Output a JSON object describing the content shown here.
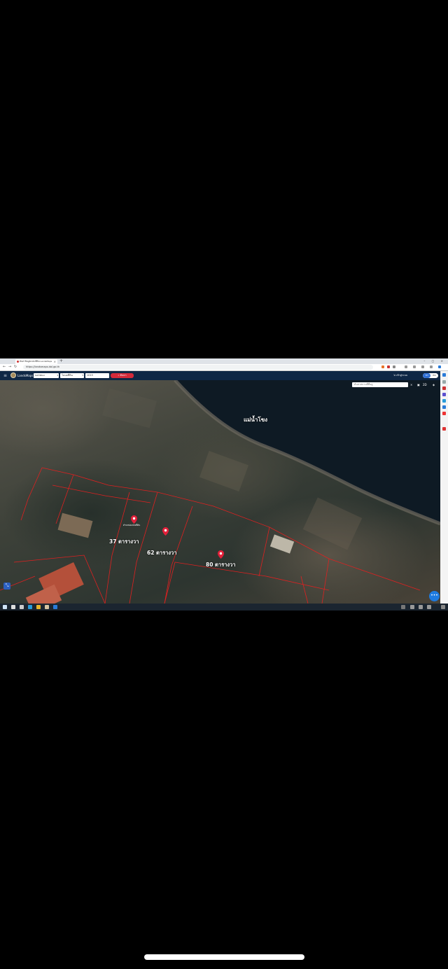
{
  "browser": {
    "tab_title": "ค้นหาข้อมูลแปลงที่ดิน LandsMaps",
    "url": "https://landsmaps.dol.go.th"
  },
  "app": {
    "brand": "LandsMaps",
    "province_select": "นครพนม",
    "parcel_type_select": "โฉนดที่ดิน",
    "parcel_number": "1015",
    "search_button": "ค้นหา",
    "login_text": "เข้าสู่ระบบ",
    "toggle_on": "TH",
    "toggle_off": "EN"
  },
  "map": {
    "search_placeholder": "ค้นหาสถานที่ที่อยู่",
    "control_label": "2D",
    "river_label": "แม่น้ำโขง",
    "pin_caption": "ตำแหน่งแปลงที่ดิน",
    "parcels": [
      {
        "label": "37 ตารางวา"
      },
      {
        "label": "62 ตารางวา"
      },
      {
        "label": "80 ตารางวา"
      }
    ],
    "fab_label": "•••"
  },
  "colors": {
    "header_bg": "#0f2745",
    "accent_red": "#d42a3a",
    "parcel_line": "#e02020",
    "water": "#0e1a24"
  }
}
